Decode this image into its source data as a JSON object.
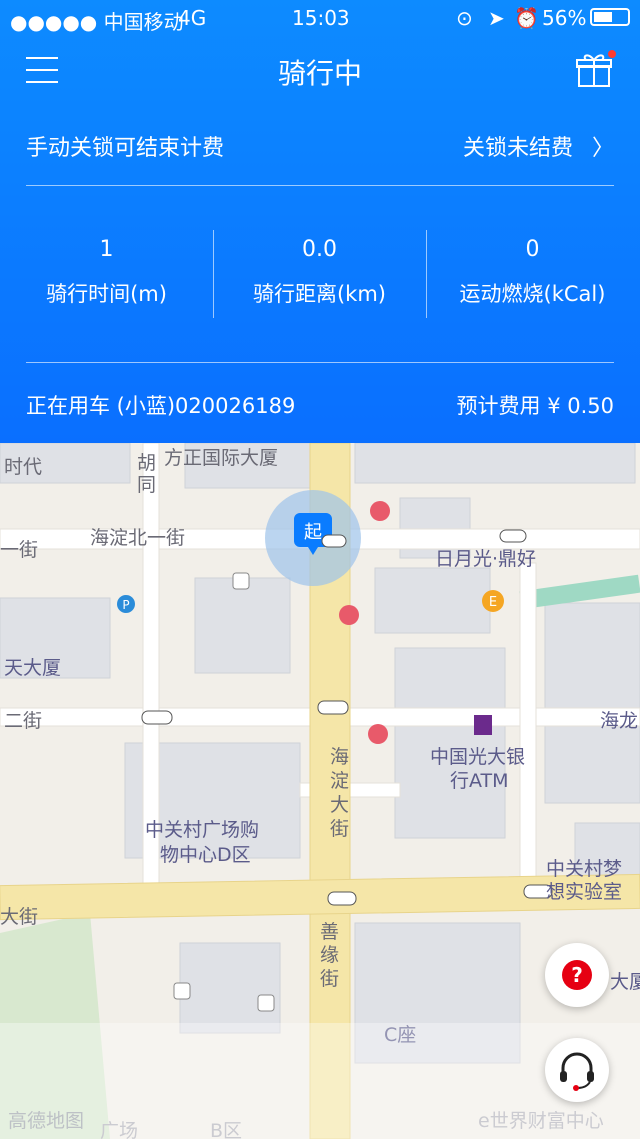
{
  "status_bar": {
    "carrier": "●●●●● 中国移动",
    "network": "4G",
    "time": "15:03",
    "battery": "56%"
  },
  "header": {
    "title": "骑行中",
    "lock_hint": "手动关锁可结束计费",
    "unlock_link": "关锁未结费"
  },
  "stats": [
    {
      "value": "1",
      "label": "骑行时间(m)"
    },
    {
      "value": "0.0",
      "label": "骑行距离(km)"
    },
    {
      "value": "0",
      "label": "运动燃烧(kCal)"
    }
  ],
  "ride_info": {
    "bike": "正在用车 (小蓝)020026189",
    "fee": "预计费用 ¥ 0.50"
  },
  "map": {
    "start_marker": "起",
    "labels": {
      "fangzheng": "方正国际大厦",
      "shidai": "时代",
      "hutong_1": "胡",
      "hutong_2": "同",
      "haidian_north": "海淀北一街",
      "yi_jie": "一街",
      "riyueguang": "日月光·鼎好",
      "tian_dasha": "天大厦",
      "er_jie": "二街",
      "hai_long": "海龙",
      "haidian_street_1": "海",
      "haidian_street_2": "淀",
      "haidian_street_3": "大",
      "haidian_street_4": "街",
      "everbright_1": "中国光大银",
      "everbright_2": "行ATM",
      "zgc_plaza_1": "中关村广场购",
      "zgc_plaza_2": "物中心D区",
      "zgc_dream_1": "中关村梦",
      "zgc_dream_2": "想实验室",
      "da_jie": "大街",
      "shanyuan_1": "善",
      "shanyuan_2": "缘",
      "shanyuan_3": "街",
      "c_zuo": "C座",
      "da_sha": "大厦",
      "amap": "高德地图",
      "guangchang": "广场",
      "b_qu": "B区",
      "e_world": "e世界财富中心"
    }
  },
  "buttons": {
    "help": "?"
  },
  "colors": {
    "header_blue": "#0a7cff",
    "help_red": "#e60012",
    "road_yellow": "#f5e6a8"
  }
}
